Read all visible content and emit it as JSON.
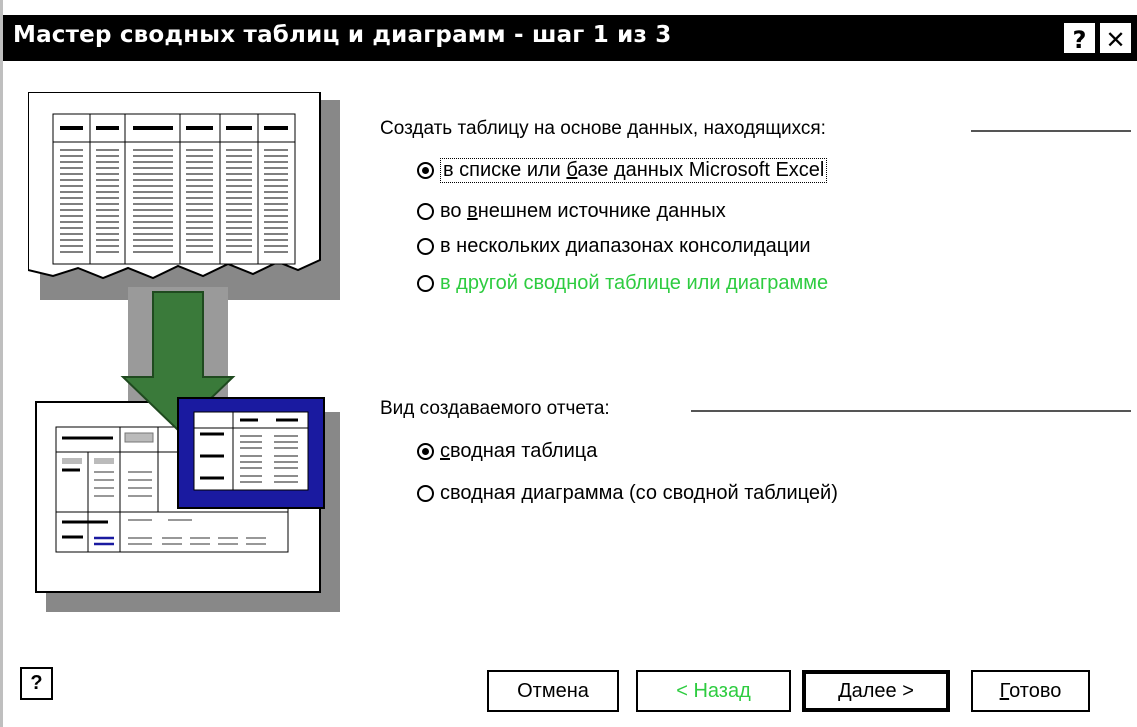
{
  "window": {
    "title": "Мастер сводных таблиц и диаграмм - шаг 1 из 3",
    "help_button": "?",
    "close_button": "✕"
  },
  "source_group": {
    "label": "Создать таблицу на основе данных, находящихся:",
    "options": [
      {
        "pre": "в списке или ",
        "u": "б",
        "post": "азе данных Microsoft Excel",
        "selected": true,
        "enabled": true
      },
      {
        "pre": "во ",
        "u": "в",
        "post": "нешнем источнике данных",
        "selected": false,
        "enabled": true
      },
      {
        "pre": "в нескольких ",
        "u": "д",
        "post": "иапазонах консолидации",
        "selected": false,
        "enabled": true
      },
      {
        "pre": "в другой сводной таблице или диаграмме",
        "u": "",
        "post": "",
        "selected": false,
        "enabled": false
      }
    ]
  },
  "report_group": {
    "label": "Вид создаваемого отчета:",
    "options": [
      {
        "pre": "",
        "u": "с",
        "post": "водная таблица",
        "selected": true,
        "enabled": true
      },
      {
        "pre": "сво",
        "u": "д",
        "post": "ная диаграмма (со сводной таблицей)",
        "selected": false,
        "enabled": true
      }
    ]
  },
  "buttons": {
    "help_icon": "?",
    "cancel": "Отмена",
    "back": "< Назад",
    "next": "Далее >",
    "finish_u": "Г",
    "finish_rest": "отово"
  },
  "colors": {
    "disabled_text": "#2ecc40",
    "arrow": "#3a7a3a",
    "pivot_frame": "#1a1aa0"
  }
}
